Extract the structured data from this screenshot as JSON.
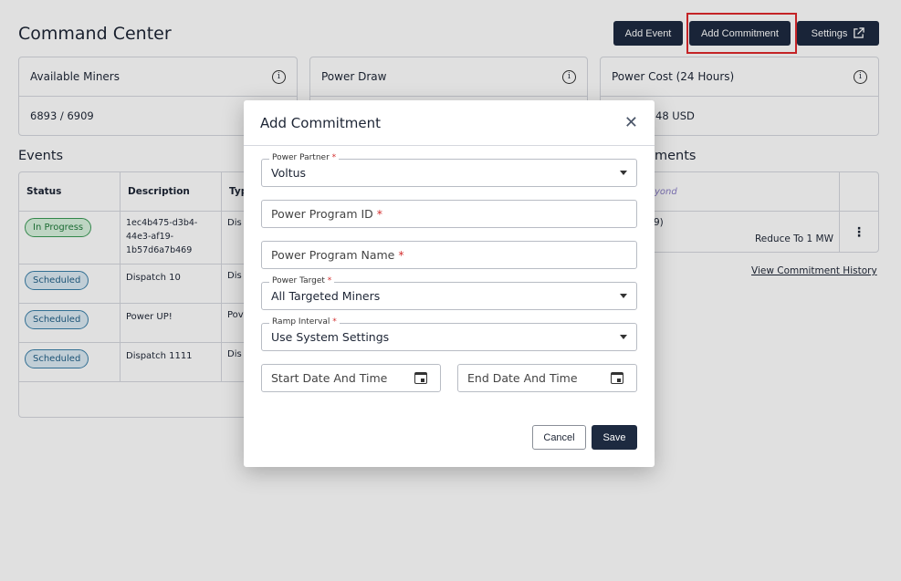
{
  "header": {
    "title": "Command Center",
    "add_event": "Add Event",
    "add_commitment": "Add Commitment",
    "settings": "Settings"
  },
  "cards": [
    {
      "label": "Available Miners",
      "value": "6893 / 6909"
    },
    {
      "label": "Power Draw",
      "value": ""
    },
    {
      "label": "Power Cost (24 Hours)",
      "value": "48 USD"
    }
  ],
  "events": {
    "title": "Events",
    "columns": [
      "Status",
      "Description",
      "Typ"
    ],
    "rows": [
      {
        "status": "In Progress",
        "description": "1ec4b475-d3b4-44e3-af19-1b57d6a7b469",
        "type": "Dis"
      },
      {
        "status": "Scheduled",
        "description": "Dispatch 10",
        "type": "Dis"
      },
      {
        "status": "Scheduled",
        "description": "Power UP!",
        "type": "Pov"
      },
      {
        "status": "Scheduled",
        "description": "Dispatch 1111",
        "type": "Dis"
      }
    ]
  },
  "commitments": {
    "title": "ments",
    "logo_text": "yond",
    "row_id": "9)",
    "row_action": "Reduce To 1 MW",
    "history_link": "View Commitment History"
  },
  "modal": {
    "title": "Add Commitment",
    "close": "✕",
    "power_partner": {
      "label": "Power Partner",
      "value": "Voltus"
    },
    "program_id": {
      "placeholder": "Power Program ID"
    },
    "program_name": {
      "placeholder": "Power Program Name"
    },
    "power_target": {
      "label": "Power Target",
      "value": "All Targeted Miners"
    },
    "ramp_interval": {
      "label": "Ramp Interval",
      "value": "Use System Settings"
    },
    "start_date": "Start Date And Time",
    "end_date": "End Date And Time",
    "cancel": "Cancel",
    "save": "Save",
    "required": "*"
  },
  "colors": {
    "primary": "#1d2a40",
    "highlight": "#e0282c",
    "in_progress": "#1f7a3a",
    "scheduled": "#1f5e86"
  }
}
